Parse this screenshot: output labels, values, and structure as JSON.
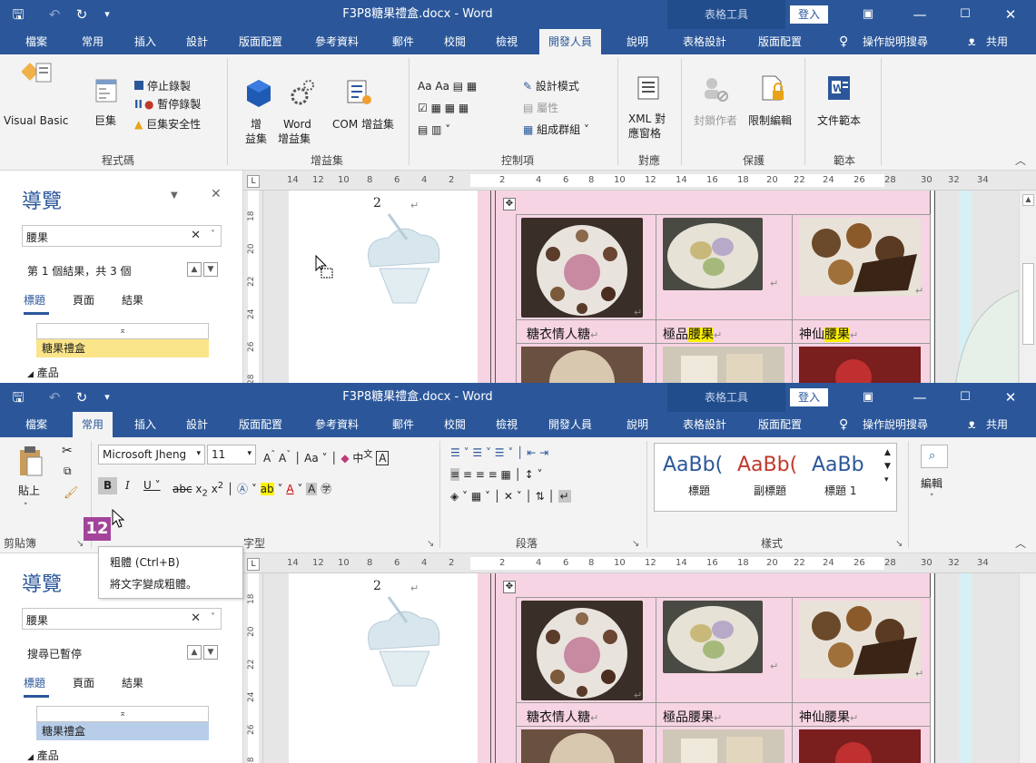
{
  "window": {
    "title": "F3P8糖果禮盒.docx - Word",
    "table_tools": "表格工具",
    "login": "登入",
    "share": "共用",
    "help_search": "操作說明搜尋"
  },
  "tabs": [
    "檔案",
    "常用",
    "插入",
    "設計",
    "版面配置",
    "參考資料",
    "郵件",
    "校閱",
    "檢視",
    "開發人員",
    "說明",
    "表格設計",
    "版面配置"
  ],
  "dev_ribbon": {
    "visual_basic": "Visual Basic",
    "macros": "巨集",
    "stop_record": "停止錄製",
    "pause_record": "暫停錄製",
    "macro_security": "巨集安全性",
    "group_code": "程式碼",
    "addins_1": "增",
    "addins_2": "益集",
    "word_addins_1": "Word",
    "word_addins_2": "增益集",
    "com_addins": "COM 增益集",
    "group_addins": "增益集",
    "design_mode": "設計模式",
    "properties": "屬性",
    "group_controls_btn": "組成群組",
    "group_controls": "控制項",
    "xml_1": "XML 對",
    "xml_2": "應窗格",
    "group_mapping": "對應",
    "block_authors": "封鎖作者",
    "restrict_editing": "限制編輯",
    "group_protect": "保護",
    "doc_template": "文件範本",
    "group_templates": "範本"
  },
  "home_ribbon": {
    "paste": "貼上",
    "group_clipboard": "剪貼簿",
    "font_name": "Microsoft Jheng",
    "font_size": "11",
    "group_font": "字型",
    "group_paragraph": "段落",
    "style_1_sample": "AaBb(",
    "style_2_sample": "AaBb(",
    "style_3_sample": "AaBb",
    "style_1": "標題",
    "style_2": "副標題",
    "style_3": "標題 1",
    "group_styles": "樣式",
    "editing": "編輯"
  },
  "ruler": [
    "14",
    "12",
    "10",
    "8",
    "6",
    "4",
    "2",
    "2",
    "4",
    "6",
    "8",
    "10",
    "12",
    "14",
    "16",
    "18",
    "20",
    "22",
    "24",
    "26",
    "28",
    "30",
    "32",
    "34"
  ],
  "vruler": [
    "18",
    "20",
    "22",
    "24",
    "26",
    "28"
  ],
  "nav1": {
    "title": "導覽",
    "query": "腰果",
    "status": "第 1 個結果，共 3 個",
    "tabs": [
      "標題",
      "頁面",
      "結果"
    ],
    "heading": "糖果禮盒",
    "sub": "產品"
  },
  "nav2": {
    "title": "導覽",
    "query": "腰果",
    "status": "搜尋已暫停",
    "tabs": [
      "標題",
      "頁面",
      "結果"
    ],
    "heading": "糖果禮盒",
    "sub": "產品"
  },
  "doc": {
    "page_number": "2",
    "captions": [
      {
        "plain": "糖衣情人糖",
        "hl": ""
      },
      {
        "plain": "極品",
        "hl": "腰果"
      },
      {
        "plain": "神仙",
        "hl": "腰果"
      }
    ]
  },
  "tooltip": {
    "title": "粗體 (Ctrl+B)",
    "desc": "將文字變成粗體。"
  },
  "step_badge": "12",
  "colors": {
    "accent": "#2b579a",
    "highlight": "#fff200",
    "badge": "#a3449a",
    "pink": "#f7d4e3"
  }
}
